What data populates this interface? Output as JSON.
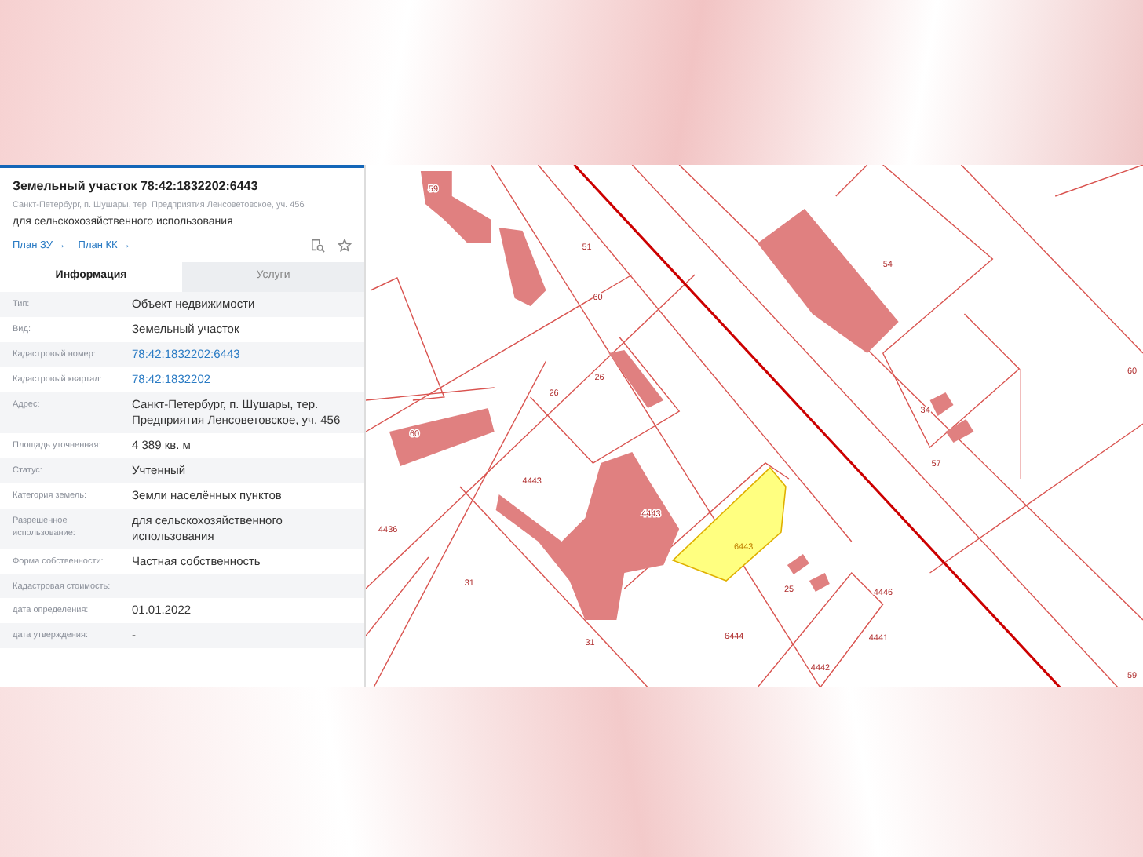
{
  "object": {
    "title": "Земельный участок 78:42:1832202:6443",
    "address": "Санкт-Петербург, п. Шушары, тер. Предприятия Ленсоветовское, уч. 456",
    "purpose": "для сельскохозяйственного использования"
  },
  "links": [
    "План ЗУ →",
    "План КК →"
  ],
  "tabs": [
    {
      "label": "Информация",
      "selected": true
    },
    {
      "label": "Услуги",
      "selected": false
    }
  ],
  "rows": [
    {
      "label": "Тип:",
      "value": "Объект недвижимости",
      "kind": "text"
    },
    {
      "label": "Вид:",
      "value": "Земельный участок",
      "kind": "text"
    },
    {
      "label": "Кадастровый номер:",
      "value": "78:42:1832202:6443",
      "kind": "link"
    },
    {
      "label": "Кадастровый квартал:",
      "value": "78:42:1832202",
      "kind": "link"
    },
    {
      "label": "Адрес:",
      "value": "Санкт-Петербург, п. Шушары, тер. Предприятия Ленсоветовское, уч. 456",
      "kind": "text"
    },
    {
      "label": "Площадь уточненная:",
      "value": "4 389 кв. м",
      "kind": "text"
    },
    {
      "label": "Статус:",
      "value": "Учтенный",
      "kind": "text"
    },
    {
      "label": "Категория земель:",
      "value": "Земли населённых пунктов",
      "kind": "text"
    },
    {
      "label": "Разрешенное использование:",
      "value": "для сельскохозяйственного использования",
      "kind": "text"
    },
    {
      "label": "Форма собственности:",
      "value": "Частная собственность",
      "kind": "text"
    },
    {
      "label": "Кадастровая стоимость:",
      "kind": "text"
    },
    {
      "label": "дата определения:",
      "value": "01.01.2022",
      "kind": "text"
    },
    {
      "label": "дата утверждения:",
      "value": "-",
      "kind": "text"
    }
  ],
  "map_labels": [
    "59",
    "51",
    "60",
    "26",
    "26",
    "60",
    "4443",
    "4443",
    "6443",
    "4436",
    "31",
    "31",
    "6444",
    "54",
    "34",
    "57",
    "60",
    "25",
    "4446",
    "4441",
    "4442",
    "59"
  ]
}
